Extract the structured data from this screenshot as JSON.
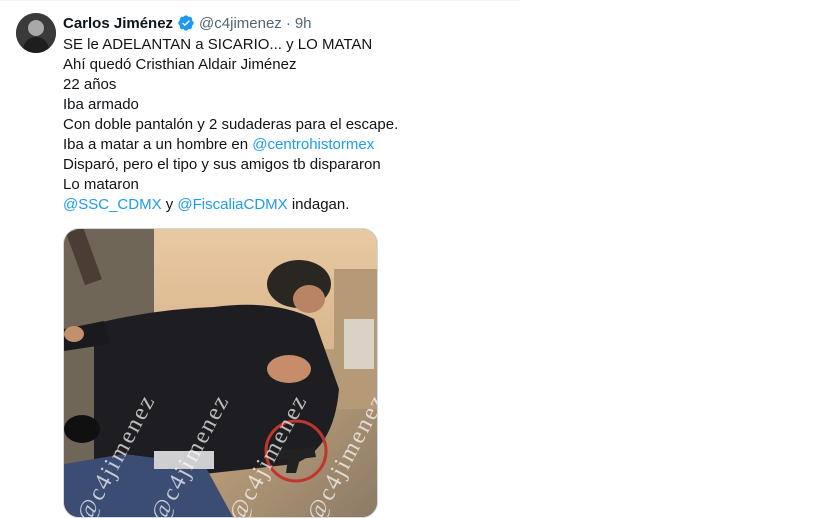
{
  "tweet": {
    "author_name": "Carlos Jiménez",
    "handle": "@c4jimenez",
    "separator": "·",
    "time": "9h",
    "lines": [
      "SE le ADELANTAN a SICARIO... y LO MATAN",
      "Ahí quedó Cristhian Aldair Jiménez",
      "22 años",
      "Iba armado",
      "Con doble pantalón y 2 sudaderas para el escape."
    ],
    "line6_prefix": "Iba a matar a un hombre en ",
    "line6_mention": "@centrohistormex",
    "line7": "Disparó, pero el tipo y sus amigos tb dispararon",
    "line8": "Lo mataron",
    "line9_mention1": "@SSC_CDMX",
    "line9_mid": " y ",
    "line9_mention2": "@FiscaliaCDMX",
    "line9_suffix": " indagan.",
    "media_watermark": "@c4jimenez"
  },
  "colors": {
    "text": "#0f1419",
    "muted": "#536471",
    "link": "#1d9bf0",
    "verified": "#1d9bf0"
  },
  "icons": {
    "verified": "verified-badge-icon"
  }
}
